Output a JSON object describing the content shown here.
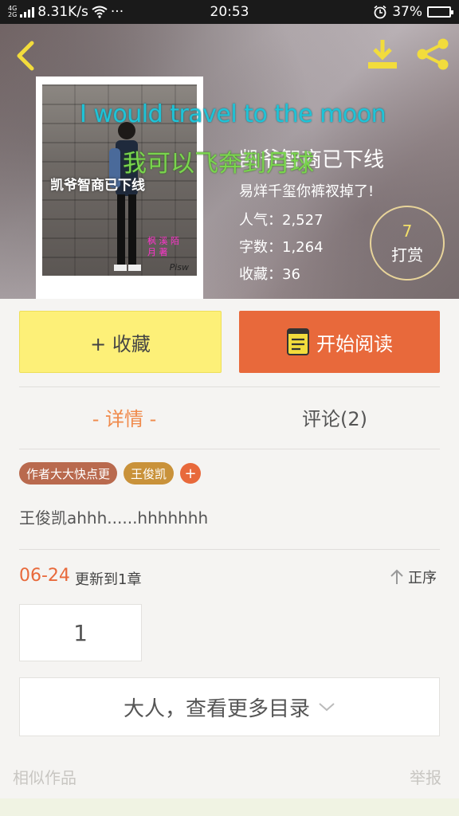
{
  "status_bar": {
    "network": "4G",
    "network2": "2G",
    "speed": "8.31K/s",
    "more": "···",
    "time": "20:53",
    "battery": "37%",
    "battery_level": 0.37
  },
  "header": {
    "overlay_en": "I would travel to the moon",
    "overlay_cn": "我可以飞奔到月球",
    "book_title": "凯爷智商已下线",
    "description": "易烊千玺你裤衩掉了!",
    "popularity": "人气：2,527",
    "word_count": "字数：1,264",
    "favorites": "收藏：36",
    "tip_count": "7",
    "tip_label": "打赏",
    "cover": {
      "title": "凯爷智商已下线",
      "side_text": "枫 溪 陌 月 著",
      "sign": "Pisw"
    }
  },
  "actions": {
    "favorite": "+ 收藏",
    "start_reading": "开始阅读"
  },
  "tabs": {
    "detail": "- 详情 -",
    "comments": "评论(2)"
  },
  "tags": [
    "作者大大快点更",
    "王俊凯",
    "+"
  ],
  "intro": "王俊凯ahhh......hhhhhhh",
  "update": {
    "date": "06-24",
    "text": "更新到1章",
    "sort": "正序"
  },
  "chapters": [
    "1"
  ],
  "more_catalog": "大人，查看更多目录",
  "footer": {
    "similar": "相似作品",
    "report": "举报"
  },
  "colors": {
    "accent": "#e8693b",
    "favorite_bg": "#fdf078",
    "tab_active": "#f08a4b",
    "overlay_en": "#1ec4d8",
    "overlay_cn": "#7ad54e"
  }
}
